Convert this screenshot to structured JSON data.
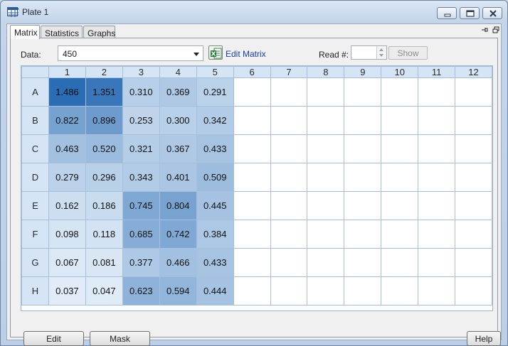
{
  "window": {
    "title": "Plate 1"
  },
  "tabs": [
    {
      "label": "Matrix",
      "active": true
    },
    {
      "label": "Statistics",
      "active": false
    },
    {
      "label": "Graphs",
      "active": false
    }
  ],
  "toolbar": {
    "data_label": "Data:",
    "data_value": "450",
    "edit_matrix_label": "Edit Matrix",
    "read_label": "Read #:",
    "read_value": "",
    "show_label": "Show"
  },
  "grid": {
    "columns": [
      "1",
      "2",
      "3",
      "4",
      "5",
      "6",
      "7",
      "8",
      "9",
      "10",
      "11",
      "12"
    ],
    "rows": [
      {
        "label": "A",
        "values": [
          "1.486",
          "1.351",
          "0.310",
          "0.369",
          "0.291",
          "",
          "",
          "",
          "",
          "",
          "",
          ""
        ]
      },
      {
        "label": "B",
        "values": [
          "0.822",
          "0.896",
          "0.253",
          "0.300",
          "0.342",
          "",
          "",
          "",
          "",
          "",
          "",
          ""
        ]
      },
      {
        "label": "C",
        "values": [
          "0.463",
          "0.520",
          "0.321",
          "0.367",
          "0.433",
          "",
          "",
          "",
          "",
          "",
          "",
          ""
        ]
      },
      {
        "label": "D",
        "values": [
          "0.279",
          "0.296",
          "0.343",
          "0.401",
          "0.509",
          "",
          "",
          "",
          "",
          "",
          "",
          ""
        ]
      },
      {
        "label": "E",
        "values": [
          "0.162",
          "0.186",
          "0.745",
          "0.804",
          "0.445",
          "",
          "",
          "",
          "",
          "",
          "",
          ""
        ]
      },
      {
        "label": "F",
        "values": [
          "0.098",
          "0.118",
          "0.685",
          "0.742",
          "0.384",
          "",
          "",
          "",
          "",
          "",
          "",
          ""
        ]
      },
      {
        "label": "G",
        "values": [
          "0.067",
          "0.081",
          "0.377",
          "0.466",
          "0.433",
          "",
          "",
          "",
          "",
          "",
          "",
          ""
        ]
      },
      {
        "label": "H",
        "values": [
          "0.037",
          "0.047",
          "0.623",
          "0.594",
          "0.444",
          "",
          "",
          "",
          "",
          "",
          "",
          ""
        ]
      }
    ],
    "heat_colors": {
      "low": "#e9f2fb",
      "high": "#2b6db4",
      "max_value": 1.486
    }
  },
  "buttons": {
    "edit": "Edit",
    "mask": "Mask",
    "help": "Help"
  }
}
